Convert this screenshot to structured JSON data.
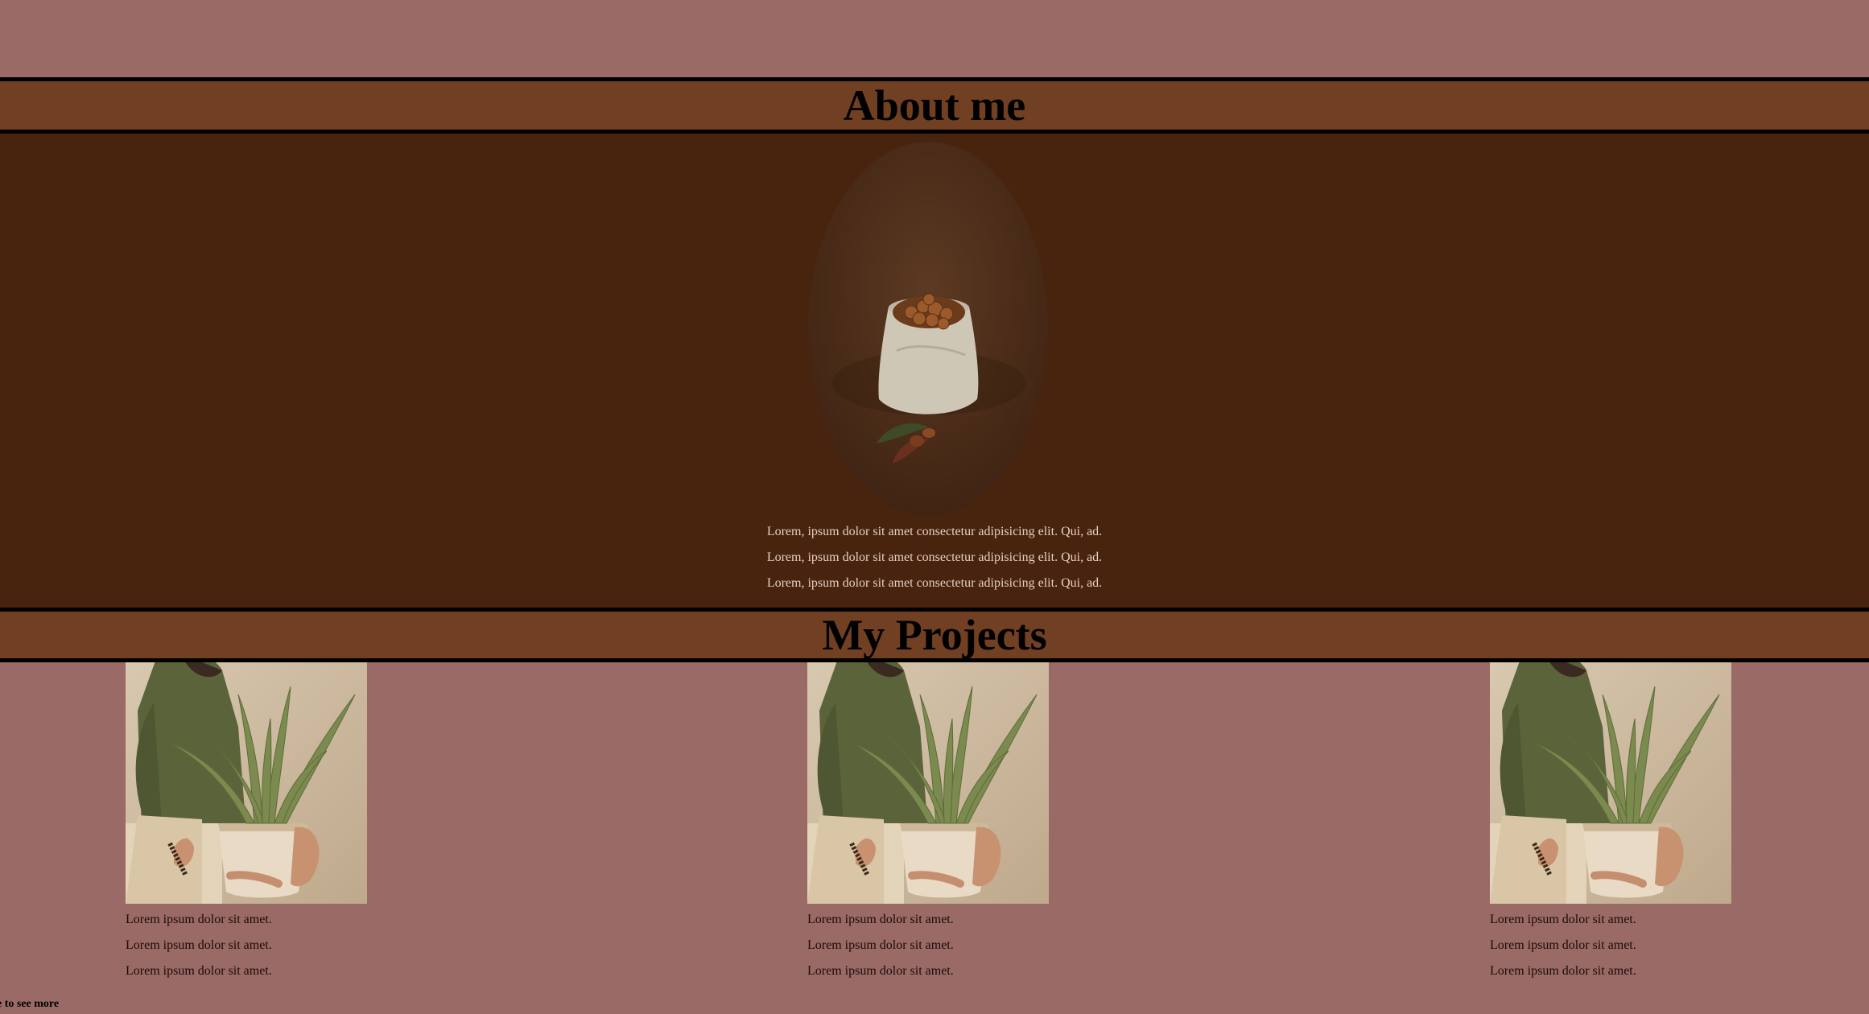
{
  "about": {
    "title": "About me",
    "lines": [
      "Lorem, ipsum dolor sit amet consectetur adipisicing elit. Qui, ad.",
      "Lorem, ipsum dolor sit amet consectetur adipisicing elit. Qui, ad.",
      "Lorem, ipsum dolor sit amet consectetur adipisicing elit. Qui, ad."
    ]
  },
  "projects": {
    "title": "My Projects",
    "cards": [
      {
        "lines": [
          "Lorem ipsum dolor sit amet.",
          "Lorem ipsum dolor sit amet.",
          "Lorem ipsum dolor sit amet."
        ]
      },
      {
        "lines": [
          "Lorem ipsum dolor sit amet.",
          "Lorem ipsum dolor sit amet.",
          "Lorem ipsum dolor sit amet."
        ]
      },
      {
        "lines": [
          "Lorem ipsum dolor sit amet.",
          "Lorem ipsum dolor sit amet.",
          "Lorem ipsum dolor sit amet."
        ]
      }
    ]
  },
  "footer": {
    "scroll_hint": "e to see more"
  },
  "colors": {
    "page_background": "#9a6a67",
    "header_band": "#713f22",
    "about_background": "#48230e",
    "about_text": "#e6cfc1"
  }
}
